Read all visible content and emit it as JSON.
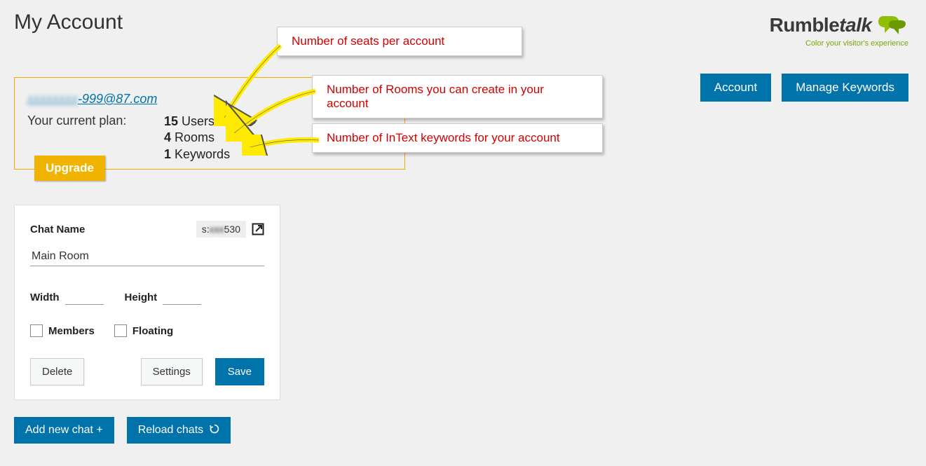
{
  "header": {
    "title": "My Account"
  },
  "logo": {
    "brand_main": "Rumble",
    "brand_sub": "talk",
    "tagline": "Color your visitor's experience"
  },
  "top_buttons": {
    "account": "Account",
    "manage_keywords": "Manage Keywords"
  },
  "account": {
    "email_hidden_prefix": "xxxxxxxx",
    "email_visible_suffix": "-999@87.com",
    "plan_label": "Your current plan:",
    "users_count": "15",
    "users_label": "Users",
    "rooms_count": "4",
    "rooms_label": "Rooms",
    "keywords_count": "1",
    "keywords_label": "Keywords",
    "upgrade": "Upgrade"
  },
  "annotations": {
    "a1": "Number of seats per account",
    "a2": "Number of Rooms you can create in your account",
    "a3": "Number of InText keywords for your account"
  },
  "chat_card": {
    "name_label": "Chat Name",
    "id_prefix": "s:",
    "id_hidden": "xxx",
    "id_suffix": "530",
    "room_value": "Main Room",
    "width_label": "Width",
    "height_label": "Height",
    "members_label": "Members",
    "floating_label": "Floating",
    "delete": "Delete",
    "settings": "Settings",
    "save": "Save"
  },
  "bottom": {
    "add_chat": "Add new chat +",
    "reload": "Reload chats"
  }
}
